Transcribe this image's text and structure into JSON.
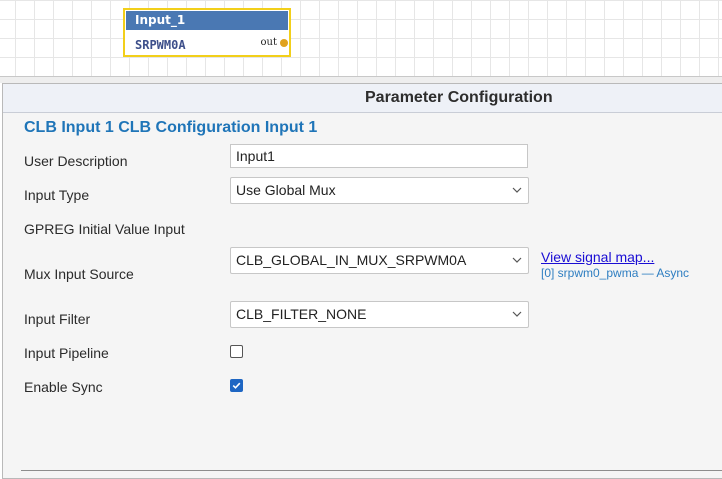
{
  "canvas": {
    "block": {
      "title": "Input_1",
      "source": "SRPWM0A",
      "port_label": "out"
    }
  },
  "panel": {
    "title": "Parameter Configuration",
    "section_title": "CLB Input 1 CLB Configuration Input 1",
    "fields": {
      "user_description": {
        "label": "User Description",
        "value": "Input1"
      },
      "input_type": {
        "label": "Input Type",
        "value": "Use Global Mux"
      },
      "gpreg_initial": {
        "label": "GPREG Initial Value Input"
      },
      "mux_input_source": {
        "label": "Mux Input Source",
        "value": "CLB_GLOBAL_IN_MUX_SRPWM0A",
        "link_text": "View signal map...",
        "signal_detail": "[0] srpwm0_pwma — Async"
      },
      "input_filter": {
        "label": "Input Filter",
        "value": "CLB_FILTER_NONE"
      },
      "input_pipeline": {
        "label": "Input Pipeline",
        "checked": false
      },
      "enable_sync": {
        "label": "Enable Sync",
        "checked": true
      }
    }
  },
  "colors": {
    "block_border": "#f2cf1a",
    "block_header": "#4a78b3",
    "section_title": "#1f75b8",
    "link": "#1a0dd4",
    "checkbox_checked": "#1e66c3"
  },
  "icons": {
    "dropdown": "chevron-down-icon",
    "check": "checkmark-icon",
    "port": "port-dot-icon"
  }
}
